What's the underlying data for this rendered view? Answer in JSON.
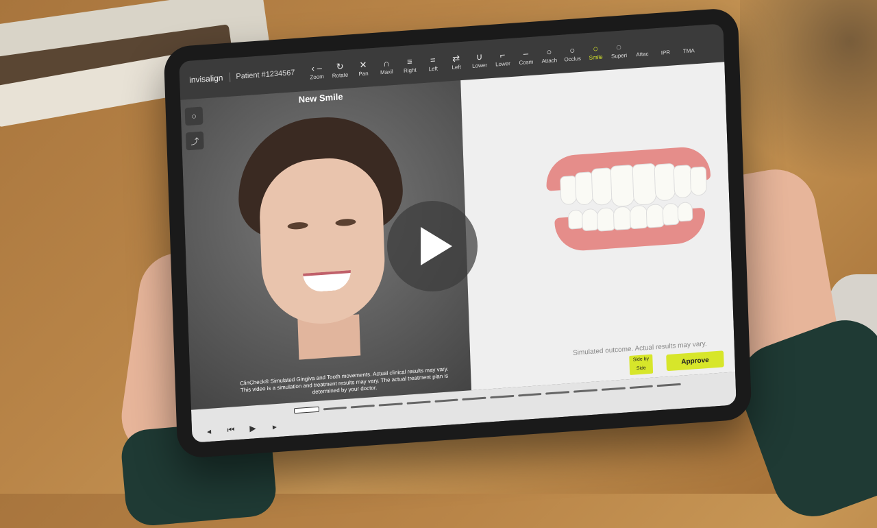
{
  "brand": "invisalign",
  "patient": "Patient #1234567",
  "toolbar": {
    "tools": [
      {
        "id": "zoom",
        "label": "Zoom",
        "icon": "‹ –",
        "active": false
      },
      {
        "id": "rotate",
        "label": "Rotate",
        "icon": "↻",
        "active": false
      },
      {
        "id": "pan",
        "label": "Pan",
        "icon": "✕",
        "active": false
      },
      {
        "id": "maxil",
        "label": "Maxil",
        "icon": "∩",
        "active": false
      },
      {
        "id": "right",
        "label": "Right",
        "icon": "≡",
        "active": false
      },
      {
        "id": "left",
        "label": "Left",
        "icon": "=",
        "active": false
      },
      {
        "id": "left2",
        "label": "Left",
        "icon": "⇄",
        "active": false
      },
      {
        "id": "lower",
        "label": "Lower",
        "icon": "∪",
        "active": false
      },
      {
        "id": "lower2",
        "label": "Lower",
        "icon": "⌐",
        "active": false
      },
      {
        "id": "cosm",
        "label": "Cosm",
        "icon": "–",
        "active": false
      },
      {
        "id": "attach",
        "label": "Attach",
        "icon": "○",
        "active": false
      },
      {
        "id": "occlus",
        "label": "Occlus",
        "icon": "○",
        "active": false
      },
      {
        "id": "smile",
        "label": "Smile",
        "icon": "○",
        "active": true
      },
      {
        "id": "superi",
        "label": "Superi",
        "icon": "◌",
        "active": false
      },
      {
        "id": "attac",
        "label": "Attac",
        "icon": "",
        "active": false
      },
      {
        "id": "ipr",
        "label": "IPR",
        "icon": "",
        "active": false
      },
      {
        "id": "tma",
        "label": "TMA",
        "icon": "",
        "active": false
      }
    ]
  },
  "left_pane": {
    "title": "New Smile",
    "side_buttons": [
      "○",
      "⤴"
    ],
    "disclaimer_line1": "ClinCheck® Simulated Gingiva and Tooth movements. Actual clinical results may vary.",
    "disclaimer_line2": "This video is a simulation and treatment results may vary. The actual treatment plan is",
    "disclaimer_line3": "determined by your doctor."
  },
  "right_pane": {
    "note": "Simulated outcome. Actual results may vary.",
    "side_by_side_label": "Side by Side",
    "approve_label": "Approve"
  },
  "bottombar": {
    "controls": [
      "◂",
      "⏮",
      "▶",
      "▸"
    ],
    "stage_count": 14,
    "current_stage": 0
  },
  "colors": {
    "accent": "#d7e62a",
    "toolbar_bg": "#3b3b3b",
    "viewer_bg": "#efefef"
  },
  "overlay": {
    "icon": "play-icon"
  }
}
